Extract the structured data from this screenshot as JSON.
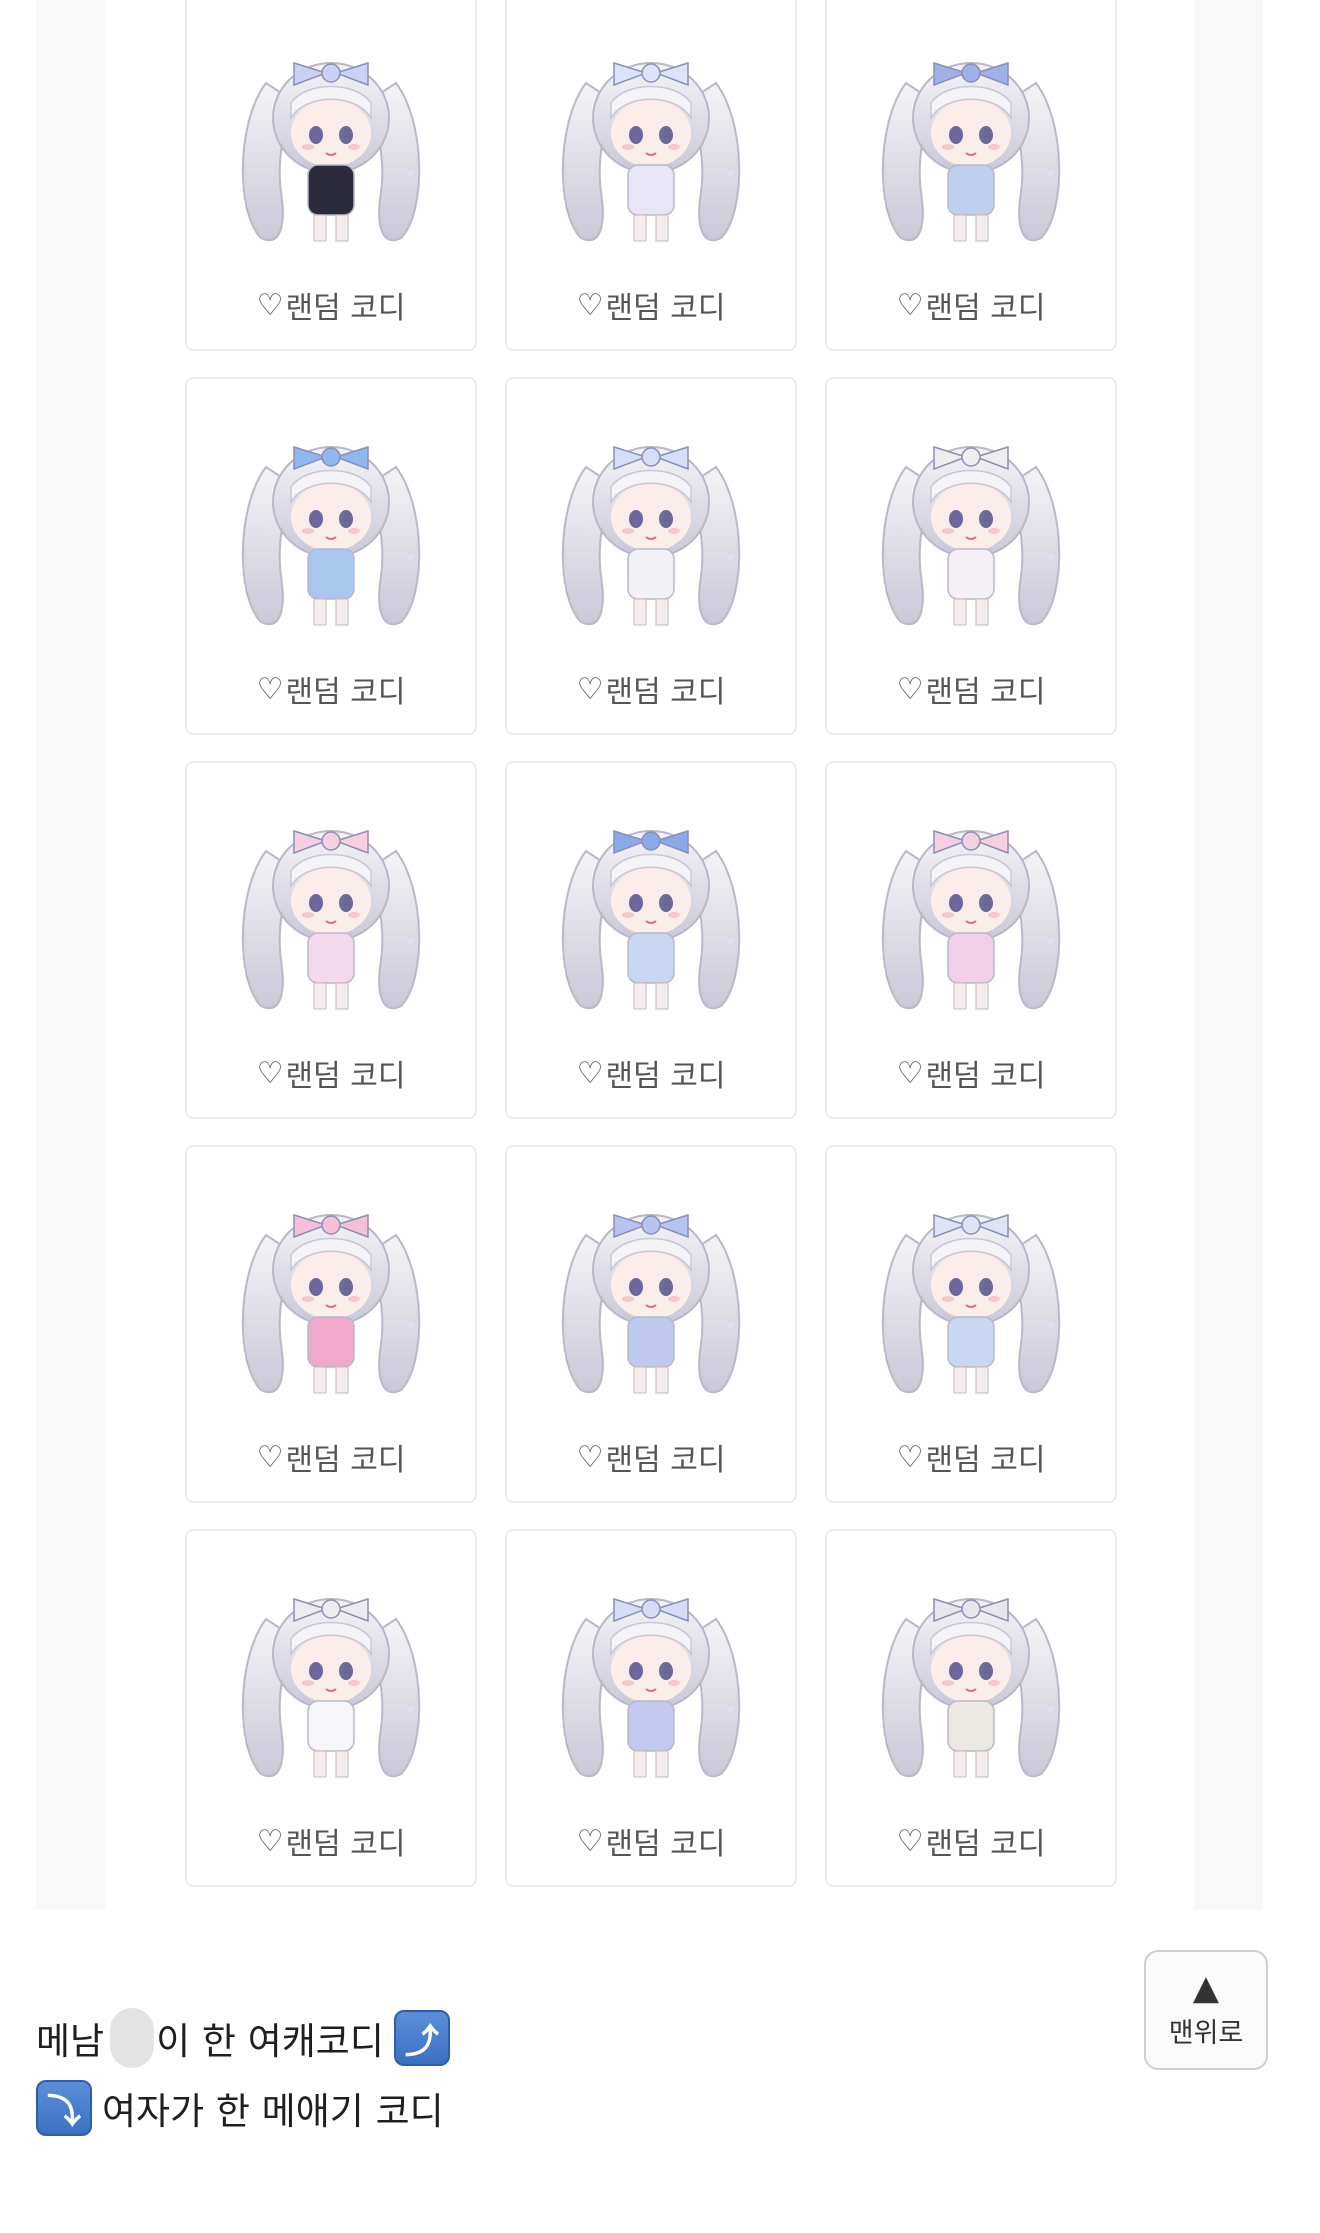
{
  "cards": [
    {
      "label": "랜덤 코디",
      "bow": "#c9d2f5",
      "outfit": "#2a2a3a"
    },
    {
      "label": "랜덤 코디",
      "bow": "#dde3f8",
      "outfit": "#e8e6f4"
    },
    {
      "label": "랜덤 코디",
      "bow": "#9fb0e8",
      "outfit": "#bcd0ee"
    },
    {
      "label": "랜덤 코디",
      "bow": "#8fb7ef",
      "outfit": "#a9c6ee"
    },
    {
      "label": "랜덤 코디",
      "bow": "#d6ddf6",
      "outfit": "#f2f2f6"
    },
    {
      "label": "랜덤 코디",
      "bow": "#eeeeee",
      "outfit": "#f4f0f6"
    },
    {
      "label": "랜덤 코디",
      "bow": "#f7cfe0",
      "outfit": "#f4d8ec"
    },
    {
      "label": "랜덤 코디",
      "bow": "#8aa9ea",
      "outfit": "#c7d7f3"
    },
    {
      "label": "랜덤 코디",
      "bow": "#f3cfe0",
      "outfit": "#f1cfe6"
    },
    {
      "label": "랜덤 코디",
      "bow": "#f5bfd8",
      "outfit": "#f0a9cb"
    },
    {
      "label": "랜덤 코디",
      "bow": "#b7c3f0",
      "outfit": "#bfc9ee"
    },
    {
      "label": "랜덤 코디",
      "bow": "#dfe3f6",
      "outfit": "#c8d8f2"
    },
    {
      "label": "랜덤 코디",
      "bow": "#ececf0",
      "outfit": "#f6f6f8"
    },
    {
      "label": "랜덤 코디",
      "bow": "#d7dcf5",
      "outfit": "#c2c8ee"
    },
    {
      "label": "랜덤 코디",
      "bow": "#e6e6ec",
      "outfit": "#ece8e4"
    }
  ],
  "bottom": {
    "line1_part1": "메남",
    "line1_part2": "이 한 여캐코디",
    "line1_emoji": "⤴",
    "line2_emoji": "⤵",
    "line2_text": "여자가 한 메애기 코디"
  },
  "top_button": {
    "arrow": "▲",
    "label": "맨위로"
  },
  "icons": {
    "heart": "♡"
  }
}
